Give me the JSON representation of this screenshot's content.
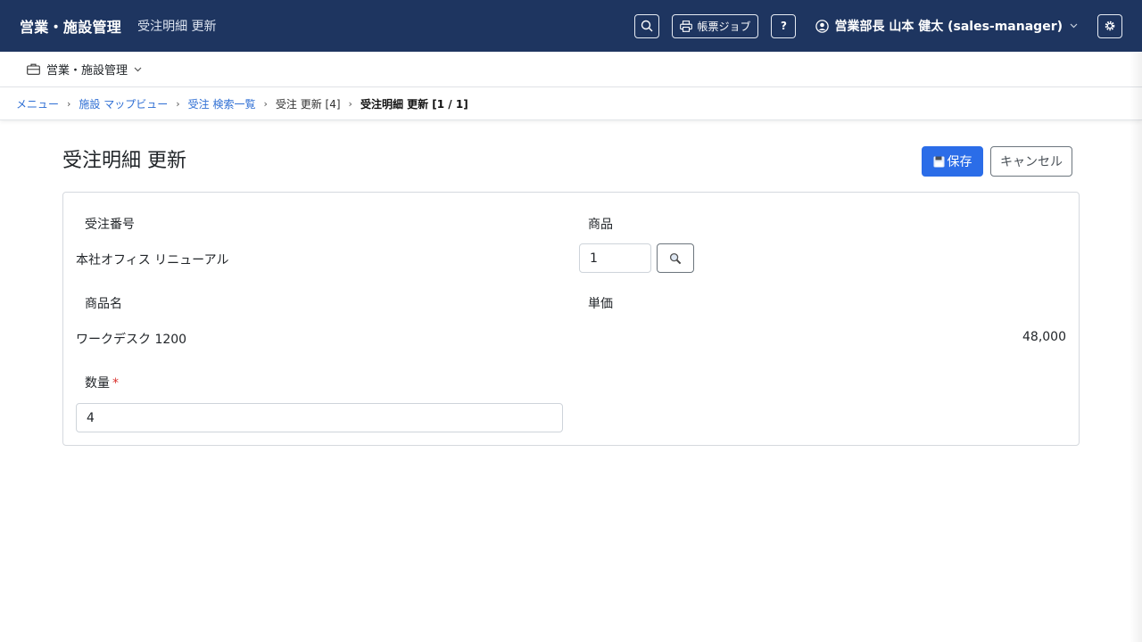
{
  "header": {
    "brand": "営業・施設管理",
    "page_subtitle": "受注明細 更新",
    "print_jobs_label": "帳票ジョブ",
    "help_label": "?",
    "user_label": "営業部長 山本 健太 (sales-manager)"
  },
  "module_bar": {
    "label": "営業・施設管理"
  },
  "breadcrumb": {
    "items": [
      "メニュー",
      "施設 マップビュー",
      "受注 検索一覧",
      "受注 更新 [4]"
    ],
    "current": "受注明細 更新 [1 / 1]"
  },
  "page": {
    "title": "受注明細 更新",
    "save_label": "保存",
    "cancel_label": "キャンセル"
  },
  "form": {
    "order_number_label": "受注番号",
    "order_number_value": "本社オフィス リニューアル",
    "product_label": "商品",
    "product_value": "1",
    "product_name_label": "商品名",
    "product_name_value": "ワークデスク 1200",
    "unit_price_label": "単価",
    "unit_price_value": "48,000",
    "quantity_label": "数量",
    "quantity_required_mark": "*",
    "quantity_value": "4"
  },
  "colors": {
    "navbar": "#1e3560",
    "primary": "#2b6de8",
    "link": "#2f6fd4",
    "required": "#d9302c"
  }
}
